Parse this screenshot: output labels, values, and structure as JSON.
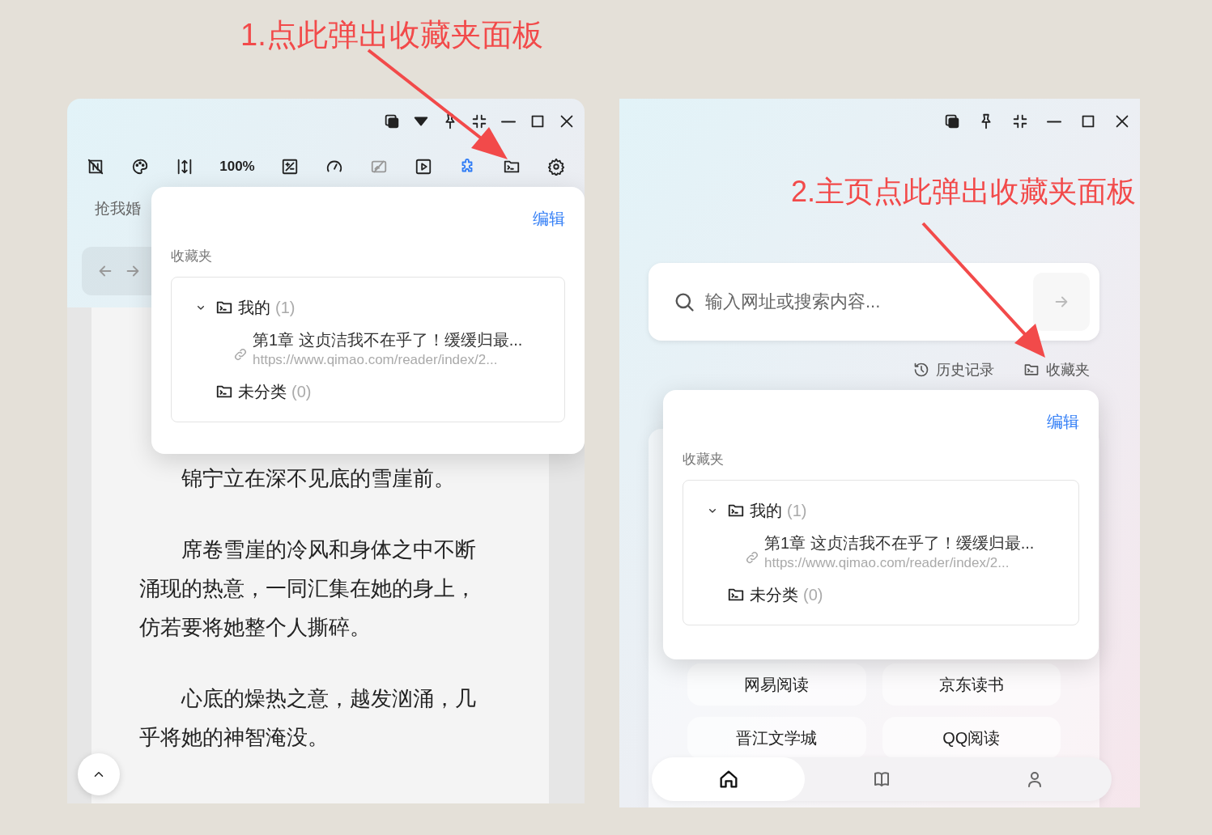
{
  "annotations": [
    {
      "text": "1.点此弹出收藏夹面板"
    },
    {
      "text": "2.主页点此弹出收藏夹面板"
    }
  ],
  "reader_window": {
    "title_controls": [
      {
        "kind": "layers"
      },
      {
        "kind": "dropdown"
      },
      {
        "kind": "pin"
      },
      {
        "kind": "shrink"
      },
      {
        "kind": "minimize"
      },
      {
        "kind": "maximize"
      },
      {
        "kind": "close"
      }
    ],
    "toolbar": [
      {
        "kind": "format-off",
        "active": false
      },
      {
        "kind": "palette",
        "active": false
      },
      {
        "kind": "line-height",
        "active": false
      },
      {
        "kind": "zoom",
        "label": "100%",
        "active": false
      },
      {
        "kind": "percent",
        "active": false
      },
      {
        "kind": "gauge",
        "active": false
      },
      {
        "kind": "image-off",
        "active": false
      },
      {
        "kind": "play",
        "active": false
      },
      {
        "kind": "extension",
        "active": true
      },
      {
        "kind": "favorites",
        "active": false
      },
      {
        "kind": "settings",
        "active": false
      }
    ],
    "tab_title": "抢我婚",
    "paragraphs": [
      "锦宁立在深不见底的雪崖前。",
      "席卷雪崖的冷风和身体之中不断涌现的热意，一同汇集在她的身上，仿若要将她整个人撕碎。",
      "心底的燥热之意，越发汹涌，几乎将她的神智淹没。"
    ],
    "favorites_panel": {
      "edit": "编辑",
      "heading": "收藏夹",
      "folders": [
        {
          "name": "我的",
          "count": "(1)",
          "expanded": true,
          "children": [
            {
              "title": "第1章 这贞洁我不在乎了！缓缓归最...",
              "url": "https://www.qimao.com/reader/index/2..."
            }
          ]
        },
        {
          "name": "未分类",
          "count": "(0)"
        }
      ]
    }
  },
  "home_window": {
    "title_controls": [
      {
        "kind": "layers"
      },
      {
        "kind": "pin"
      },
      {
        "kind": "shrink"
      },
      {
        "kind": "minimize"
      },
      {
        "kind": "maximize"
      },
      {
        "kind": "close"
      }
    ],
    "search": {
      "placeholder": "输入网址或搜索内容..."
    },
    "links": [
      {
        "kind": "history",
        "label": "历史记录"
      },
      {
        "kind": "favorites",
        "label": "收藏夹"
      }
    ],
    "favorites_panel": {
      "edit": "编辑",
      "heading": "收藏夹",
      "folders": [
        {
          "name": "我的",
          "count": "(1)",
          "expanded": true,
          "children": [
            {
              "title": "第1章 这贞洁我不在乎了！缓缓归最...",
              "url": "https://www.qimao.com/reader/index/2..."
            }
          ]
        },
        {
          "name": "未分类",
          "count": "(0)"
        }
      ]
    },
    "sites": [
      "网易阅读",
      "京东读书",
      "晋江文学城",
      "QQ阅读"
    ],
    "nav": [
      {
        "kind": "home",
        "selected": true
      },
      {
        "kind": "bookshelf",
        "selected": false
      },
      {
        "kind": "profile",
        "selected": false
      }
    ]
  }
}
